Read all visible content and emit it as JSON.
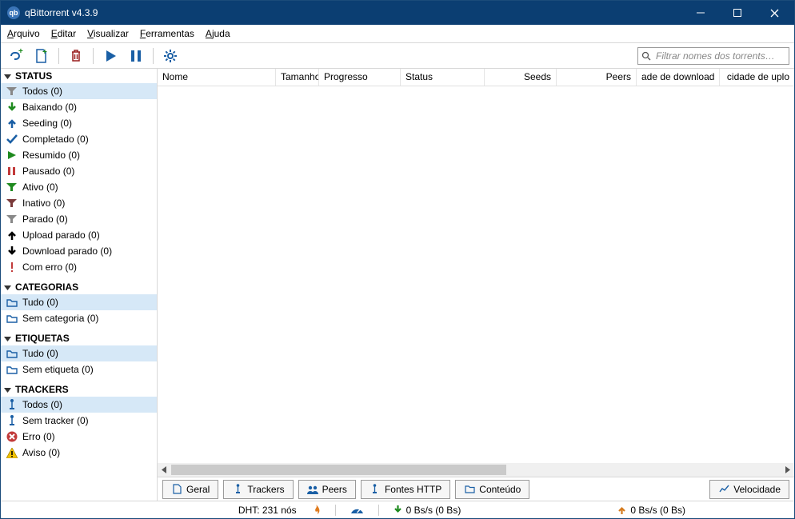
{
  "title": "qBittorrent v4.3.9",
  "menus": {
    "arquivo": "Arquivo",
    "editar": "Editar",
    "visualizar": "Visualizar",
    "ferramentas": "Ferramentas",
    "ajuda": "Ajuda"
  },
  "search_placeholder": "Filtrar nomes dos torrents…",
  "sidebar": {
    "status": {
      "header": "STATUS",
      "items": [
        {
          "label": "Todos (0)"
        },
        {
          "label": "Baixando (0)"
        },
        {
          "label": "Seeding (0)"
        },
        {
          "label": "Completado (0)"
        },
        {
          "label": "Resumido (0)"
        },
        {
          "label": "Pausado (0)"
        },
        {
          "label": "Ativo (0)"
        },
        {
          "label": "Inativo (0)"
        },
        {
          "label": "Parado (0)"
        },
        {
          "label": "Upload parado (0)"
        },
        {
          "label": "Download parado (0)"
        },
        {
          "label": "Com erro (0)"
        }
      ]
    },
    "categorias": {
      "header": "CATEGORIAS",
      "items": [
        {
          "label": "Tudo (0)"
        },
        {
          "label": "Sem categoria (0)"
        }
      ]
    },
    "etiquetas": {
      "header": "ETIQUETAS",
      "items": [
        {
          "label": "Tudo (0)"
        },
        {
          "label": "Sem etiqueta (0)"
        }
      ]
    },
    "trackers": {
      "header": "TRACKERS",
      "items": [
        {
          "label": "Todos (0)"
        },
        {
          "label": "Sem tracker (0)"
        },
        {
          "label": "Erro (0)"
        },
        {
          "label": "Aviso (0)"
        }
      ]
    }
  },
  "columns": {
    "nome": "Nome",
    "tamanho": "Tamanho",
    "progresso": "Progresso",
    "status": "Status",
    "seeds": "Seeds",
    "peers": "Peers",
    "vel_down": "ade de download",
    "vel_up": "cidade de uplo"
  },
  "bottom_tabs": {
    "geral": "Geral",
    "trackers": "Trackers",
    "peers": "Peers",
    "fontes_http": "Fontes HTTP",
    "conteudo": "Conteúdo",
    "velocidade": "Velocidade"
  },
  "statusbar": {
    "dht": "DHT: 231 nós",
    "down": "0 Bs/s (0 Bs)",
    "up": "0 Bs/s (0 Bs)"
  }
}
